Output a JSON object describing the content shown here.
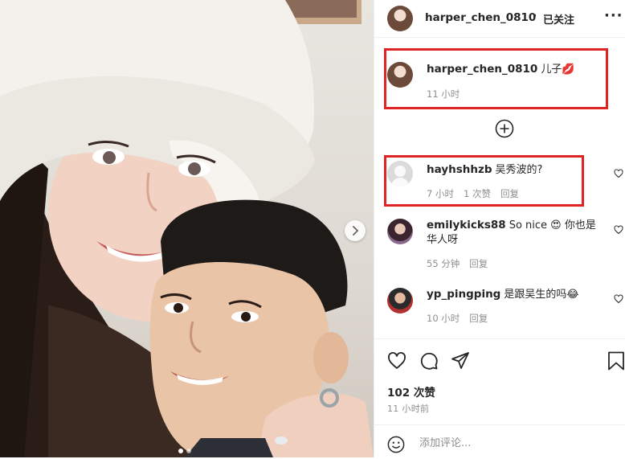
{
  "post": {
    "author": "harper_chen_0810",
    "follow_label": "已关注",
    "separator": "·",
    "more": "···",
    "caption_text": "儿子💋",
    "caption_time": "11 小时"
  },
  "comments": [
    {
      "user": "hayhshhzb",
      "text": "吴秀波的?",
      "time": "7 小时",
      "likes": "1 次赞",
      "reply": "回复"
    },
    {
      "user": "emilykicks88",
      "text": "So nice 😍 你也是华人呀",
      "time": "55 分钟",
      "reply": "回复"
    },
    {
      "user": "yp_pingping",
      "text": "是跟吴生的吗😂",
      "time": "10 小时",
      "reply": "回复"
    }
  ],
  "footer": {
    "likes": "102 次赞",
    "time": "11 小时前",
    "comment_placeholder": "添加评论..."
  },
  "carousel": {
    "slides": 2,
    "active": 1
  },
  "colors": {
    "highlight": "#e02424",
    "muted": "#8e8e8e",
    "text": "#262626"
  },
  "icons": [
    "heart-icon",
    "comment-icon",
    "share-icon",
    "bookmark-icon",
    "plus-circle-icon",
    "emoji-icon",
    "chevron-right-icon"
  ]
}
